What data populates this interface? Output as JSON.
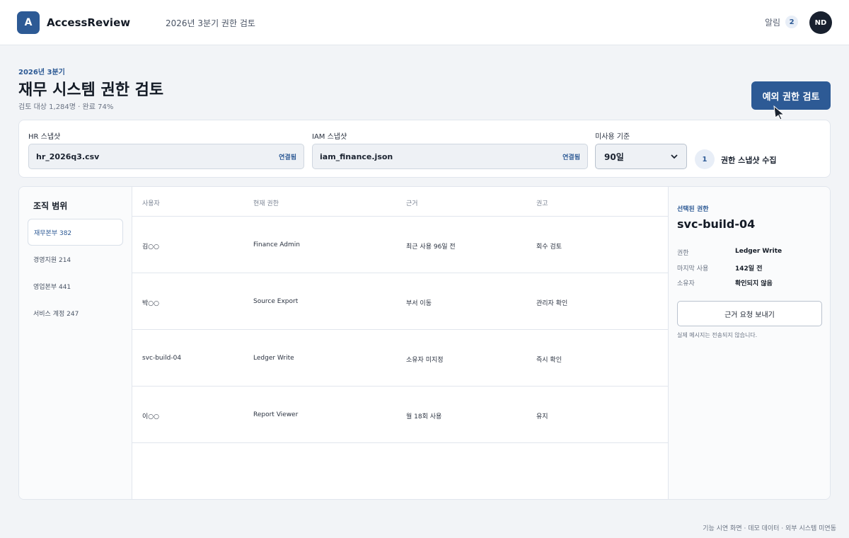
{
  "app": {
    "logo_letter": "A",
    "name": "AccessReview",
    "breadcrumb": "2026년 3분기 권한 검토",
    "notifications_label": "알림",
    "notifications_count": "2",
    "avatar_initials": "ND"
  },
  "header": {
    "quarter": "2026년 3분기",
    "title": "재무 시스템 권한 검토",
    "meta": "검토 대상 1,284명 · 완료 74%",
    "exception_button": "예외 권한 검토"
  },
  "snapshots": {
    "hr": {
      "label": "HR 스냅샷",
      "value": "hr_2026q3.csv",
      "status": "연결됨"
    },
    "iam": {
      "label": "IAM 스냅샷",
      "value": "iam_finance.json",
      "status": "연결됨"
    },
    "unused": {
      "label": "미사용 기준",
      "value": "90일"
    },
    "step": {
      "number": "1",
      "label": "권한 스냅샷 수집"
    }
  },
  "org_scope": {
    "title": "조직 범위",
    "items": [
      {
        "label": "재무본부 382"
      },
      {
        "label": "경영지원 214"
      },
      {
        "label": "영업본부 441"
      },
      {
        "label": "서비스 계정 247"
      }
    ]
  },
  "table": {
    "headers": [
      "사용자",
      "현재 권한",
      "근거",
      "권고"
    ],
    "rows": [
      [
        "김○○",
        "Finance Admin",
        "최근 사용 96일 전",
        "회수 검토"
      ],
      [
        "박○○",
        "Source Export",
        "부서 이동",
        "관리자 확인"
      ],
      [
        "svc-build-04",
        "Ledger Write",
        "소유자 미지정",
        "즉시 확인"
      ],
      [
        "이○○",
        "Report Viewer",
        "월 18회 사용",
        "유지"
      ]
    ]
  },
  "detail": {
    "kicker": "선택된 권한",
    "title": "svc-build-04",
    "fields": [
      {
        "label": "권한",
        "value": "Ledger Write"
      },
      {
        "label": "마지막 사용",
        "value": "142일 전"
      },
      {
        "label": "소유자",
        "value": "확인되지 않음"
      }
    ],
    "button": "근거 요청 보내기",
    "note": "실제 메시지는 전송되지 않습니다."
  },
  "footer": "기능 시연 화면 · 데모 데이터 · 외부 시스템 미연동",
  "colors": {
    "accent": "#2d5a95",
    "dark": "#18202e"
  }
}
